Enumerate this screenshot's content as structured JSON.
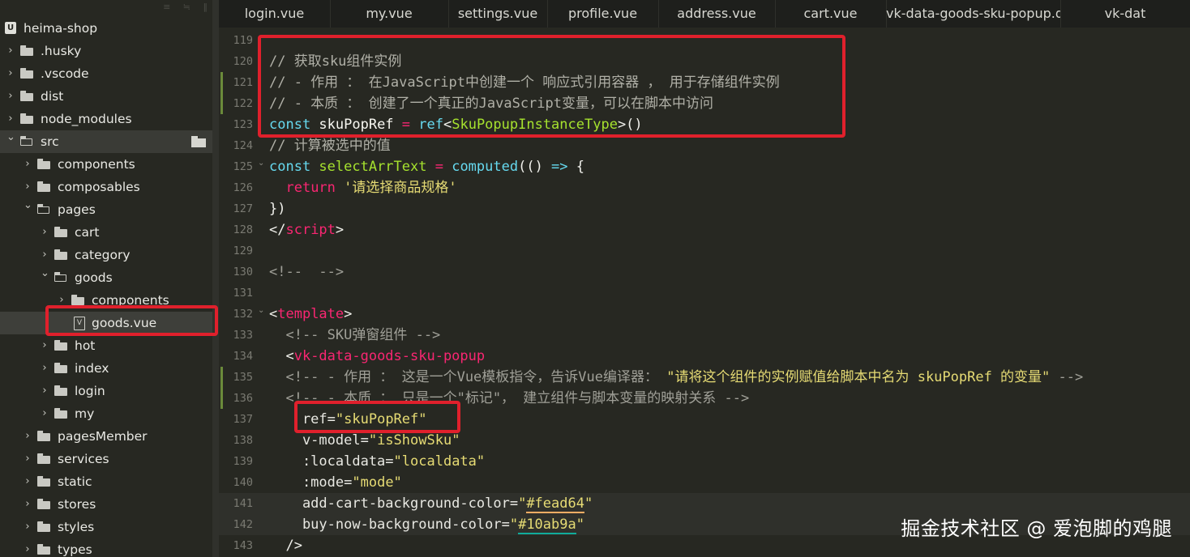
{
  "sidebar": {
    "project": "heima-shop",
    "items": [
      {
        "label": ".husky",
        "type": "folder",
        "expanded": false,
        "depth": 0
      },
      {
        "label": ".vscode",
        "type": "folder",
        "expanded": false,
        "depth": 0
      },
      {
        "label": "dist",
        "type": "folder",
        "expanded": false,
        "depth": 0
      },
      {
        "label": "node_modules",
        "type": "folder",
        "expanded": false,
        "depth": 0
      },
      {
        "label": "src",
        "type": "folder",
        "expanded": true,
        "depth": 0
      },
      {
        "label": "components",
        "type": "folder",
        "expanded": false,
        "depth": 1
      },
      {
        "label": "composables",
        "type": "folder",
        "expanded": false,
        "depth": 1
      },
      {
        "label": "pages",
        "type": "folder",
        "expanded": true,
        "depth": 1
      },
      {
        "label": "cart",
        "type": "folder",
        "expanded": false,
        "depth": 2
      },
      {
        "label": "category",
        "type": "folder",
        "expanded": false,
        "depth": 2
      },
      {
        "label": "goods",
        "type": "folder",
        "expanded": true,
        "depth": 2
      },
      {
        "label": "components",
        "type": "folder",
        "expanded": false,
        "depth": 3
      },
      {
        "label": "goods.vue",
        "type": "file",
        "expanded": false,
        "depth": 3,
        "selected": true
      },
      {
        "label": "hot",
        "type": "folder",
        "expanded": false,
        "depth": 2
      },
      {
        "label": "index",
        "type": "folder",
        "expanded": false,
        "depth": 2
      },
      {
        "label": "login",
        "type": "folder",
        "expanded": false,
        "depth": 2
      },
      {
        "label": "my",
        "type": "folder",
        "expanded": false,
        "depth": 2
      },
      {
        "label": "pagesMember",
        "type": "folder",
        "expanded": false,
        "depth": 1
      },
      {
        "label": "services",
        "type": "folder",
        "expanded": false,
        "depth": 1
      },
      {
        "label": "static",
        "type": "folder",
        "expanded": false,
        "depth": 1
      },
      {
        "label": "stores",
        "type": "folder",
        "expanded": false,
        "depth": 1
      },
      {
        "label": "styles",
        "type": "folder",
        "expanded": false,
        "depth": 1
      },
      {
        "label": "types",
        "type": "folder",
        "expanded": false,
        "depth": 1
      }
    ]
  },
  "tabs": [
    {
      "label": "login.vue"
    },
    {
      "label": "my.vue"
    },
    {
      "label": "settings.vue"
    },
    {
      "label": "profile.vue"
    },
    {
      "label": "address.vue"
    },
    {
      "label": "cart.vue"
    },
    {
      "label": "vk-data-goods-sku-popup.d.ts"
    },
    {
      "label": "vk-dat"
    }
  ],
  "editor": {
    "lines": [
      {
        "num": "119",
        "tokens": []
      },
      {
        "num": "120",
        "tokens": [
          [
            "c-com",
            "// 获取sku组件实例"
          ]
        ]
      },
      {
        "num": "121",
        "tokens": [
          [
            "c-com",
            "// - 作用 ： 在JavaScript中创建一个 响应式引用容器 ， 用于存储组件实例"
          ]
        ]
      },
      {
        "num": "122",
        "tokens": [
          [
            "c-com",
            "// - 本质 ： 创建了一个真正的JavaScript变量，可以在脚本中访问"
          ]
        ]
      },
      {
        "num": "123",
        "tokens": [
          [
            "c-kw",
            "const "
          ],
          [
            "c-var",
            "skuPopRef "
          ],
          [
            "c-op",
            "= "
          ],
          [
            "c-fn",
            "ref"
          ],
          [
            "c-plain",
            "<"
          ],
          [
            "c-type",
            "SkuPopupInstanceType"
          ],
          [
            "c-plain",
            ">()"
          ]
        ]
      },
      {
        "num": "124",
        "tokens": [
          [
            "c-com",
            "// 计算被选中的值"
          ]
        ]
      },
      {
        "num": "125",
        "tokens": [
          [
            "c-kw",
            "const "
          ],
          [
            "c-type",
            "selectArrText "
          ],
          [
            "c-op",
            "= "
          ],
          [
            "c-fn",
            "computed"
          ],
          [
            "c-plain",
            "(() "
          ],
          [
            "c-kw",
            "=> "
          ],
          [
            "c-plain",
            "{"
          ]
        ]
      },
      {
        "num": "126",
        "tokens": [
          [
            "c-plain",
            "  "
          ],
          [
            "c-op",
            "return "
          ],
          [
            "c-str",
            "'请选择商品规格'"
          ]
        ]
      },
      {
        "num": "127",
        "tokens": [
          [
            "c-plain",
            "})"
          ]
        ]
      },
      {
        "num": "128",
        "tokens": [
          [
            "c-plain",
            "</"
          ],
          [
            "c-tag",
            "script"
          ],
          [
            "c-plain",
            ">"
          ]
        ]
      },
      {
        "num": "129",
        "tokens": []
      },
      {
        "num": "130",
        "tokens": [
          [
            "c-cmt2",
            "<!--  -->"
          ]
        ]
      },
      {
        "num": "131",
        "tokens": []
      },
      {
        "num": "132",
        "tokens": [
          [
            "c-plain",
            "<"
          ],
          [
            "c-tag",
            "template"
          ],
          [
            "c-plain",
            ">"
          ]
        ]
      },
      {
        "num": "133",
        "tokens": [
          [
            "c-cmt2",
            "  <!-- SKU弹窗组件 -->"
          ]
        ]
      },
      {
        "num": "134",
        "tokens": [
          [
            "c-plain",
            "  <"
          ],
          [
            "c-tag",
            "vk-data-goods-sku-popup"
          ]
        ]
      },
      {
        "num": "135",
        "tokens": [
          [
            "c-cmt2",
            "  <!-- - 作用 ： 这是一个Vue模板指令，告诉Vue编译器： "
          ],
          [
            "c-str",
            "\"请将这个组件的实例赋值给脚本中名为 skuPopRef 的变量\""
          ],
          [
            "c-cmt2",
            " -->"
          ]
        ]
      },
      {
        "num": "136",
        "tokens": [
          [
            "c-cmt2",
            "  <!-- - 本质 ： 只是一个\"标记\"， 建立组件与脚本变量的映射关系 -->"
          ]
        ]
      },
      {
        "num": "137",
        "tokens": [
          [
            "c-attr",
            "    ref"
          ],
          [
            "c-plain",
            "="
          ],
          [
            "c-str",
            "\"skuPopRef\""
          ]
        ]
      },
      {
        "num": "138",
        "tokens": [
          [
            "c-attr",
            "    v-model"
          ],
          [
            "c-plain",
            "="
          ],
          [
            "c-str",
            "\"isShowSku\""
          ]
        ]
      },
      {
        "num": "139",
        "tokens": [
          [
            "c-attr",
            "    :localdata"
          ],
          [
            "c-plain",
            "="
          ],
          [
            "c-str",
            "\"localdata\""
          ]
        ]
      },
      {
        "num": "140",
        "tokens": [
          [
            "c-attr",
            "    :mode"
          ],
          [
            "c-plain",
            "="
          ],
          [
            "c-str",
            "\"mode\""
          ]
        ]
      },
      {
        "num": "141",
        "tokens": [
          [
            "c-attr",
            "    add-cart-background-color"
          ],
          [
            "c-plain",
            "="
          ],
          [
            "c-str",
            "\""
          ],
          [
            "c-str ul-orange",
            "#fead64"
          ],
          [
            "c-str",
            "\""
          ]
        ]
      },
      {
        "num": "142",
        "tokens": [
          [
            "c-attr",
            "    buy-now-background-color"
          ],
          [
            "c-plain",
            "="
          ],
          [
            "c-str",
            "\""
          ],
          [
            "c-str ul-teal",
            "#10ab9a"
          ],
          [
            "c-str",
            "\""
          ]
        ]
      },
      {
        "num": "143",
        "tokens": [
          [
            "c-plain",
            "  />"
          ]
        ]
      }
    ]
  },
  "watermark": "掘金技术社区 @ 爱泡脚的鸡腿",
  "colors": {
    "background": "#272822",
    "highlight_box": "#e0202c",
    "orange_swatch": "#fead64",
    "teal_swatch": "#10ab9a"
  }
}
